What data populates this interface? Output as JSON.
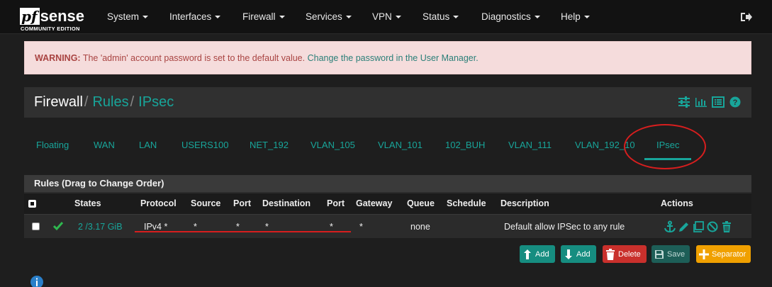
{
  "brand": {
    "logo_pf": "pf",
    "logo_sense": "sense",
    "edition": "COMMUNITY EDITION"
  },
  "nav": {
    "items": [
      {
        "label": "System"
      },
      {
        "label": "Interfaces"
      },
      {
        "label": "Firewall"
      },
      {
        "label": "Services"
      },
      {
        "label": "VPN"
      },
      {
        "label": "Status"
      },
      {
        "label": "Diagnostics"
      },
      {
        "label": "Help"
      }
    ],
    "logout_icon": "sign-out-icon"
  },
  "alert": {
    "prefix": "WARNING:",
    "message": " The 'admin' account password is set to the default value. ",
    "link": "Change the password in the User Manager."
  },
  "breadcrumb": {
    "items": [
      "Firewall",
      "Rules",
      "IPsec"
    ],
    "separator": "/",
    "icons": [
      "sliders-icon",
      "bar-chart-icon",
      "list-icon",
      "help-icon"
    ]
  },
  "tabs": {
    "items": [
      "Floating",
      "WAN",
      "LAN",
      "USERS100",
      "NET_192",
      "VLAN_105",
      "VLAN_101",
      "102_BUH",
      "VLAN_111",
      "VLAN_192_10",
      "IPsec"
    ],
    "active": "IPsec"
  },
  "rules_panel": {
    "title": "Rules (Drag to Change Order)",
    "columns": [
      "States",
      "Protocol",
      "Source",
      "Port",
      "Destination",
      "Port",
      "Gateway",
      "Queue",
      "Schedule",
      "Description",
      "Actions"
    ],
    "rows": [
      {
        "states": "2 /3.17 GiB",
        "protocol": "IPv4 *",
        "source": "*",
        "source_port": "*",
        "destination": "*",
        "destination_port": "*",
        "gateway": "*",
        "queue": "none",
        "schedule": "",
        "description": "Default allow IPSec to any rule",
        "enabled_icon": "check-icon",
        "action_icons": [
          "anchor-icon",
          "pencil-icon",
          "copy-icon",
          "disable-icon",
          "trash-icon"
        ]
      }
    ]
  },
  "buttons": {
    "add_top": "Add",
    "add_bottom": "Add",
    "delete": "Delete",
    "save": "Save",
    "separator": "Separator"
  },
  "colors": {
    "accent": "#18a59a",
    "danger": "#c9302c",
    "warning": "#f0a000",
    "annotation_red": "#d71e1e"
  }
}
